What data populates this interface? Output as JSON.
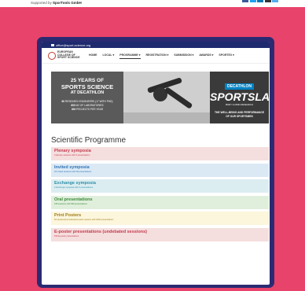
{
  "top": {
    "supported_prefix": "Supported by",
    "supporter": "SporTools GmbH",
    "social_colors": [
      "#3b5998",
      "#1da1f2",
      "#0077b5",
      "#333333",
      "#55acee"
    ]
  },
  "infobar": {
    "email": "office@sport-science.org"
  },
  "nav": {
    "logo_text": "EUROPEAN COLLEGE OF SPORT SCIENCE",
    "items": [
      {
        "label": "HOME",
        "active": false
      },
      {
        "label": "LOCAL ▾",
        "active": false
      },
      {
        "label": "PROGRAMME ▾",
        "active": true
      },
      {
        "label": "REGISTRATION ▾",
        "active": false
      },
      {
        "label": "SUBMISSION ▾",
        "active": false
      },
      {
        "label": "AWARDS ▾",
        "active": false
      },
      {
        "label": "SPORTEX ▾",
        "active": false
      }
    ]
  },
  "hero": {
    "left_title_1": "25 YEARS OF",
    "left_title_2": "SPORTS SCIENCE",
    "left_title_3": "AT DECATHLON",
    "stats": [
      {
        "value": "60",
        "text": " RESEARCH ENGINEERS (17 WITH PHD)"
      },
      {
        "value": "800",
        "text": " M2 OF LABORATORIES"
      },
      {
        "value": "300",
        "text": " PROJECTS PER YEAR"
      }
    ],
    "brand": "DECATHLON",
    "brand_color": "#0082c3",
    "sportslab": "SPORTSLAB",
    "sportslab_sub": "BODY & MIND RESEARCH",
    "tagline_1": "THE WELL-BEING AND PERFORMANCE",
    "tagline_2": "OF OUR SPORTSMEN"
  },
  "heading": "Scientific Programme",
  "sessions": [
    {
      "title": "Plenary symposia",
      "subtitle": "3 plenary sessions with 9 presentations",
      "bg": "#f5dede",
      "color": "#c23b4e"
    },
    {
      "title": "Invited symposia",
      "subtitle": "22 invited sessions with 66 presentations",
      "bg": "#dbe9f5",
      "color": "#2f74b5"
    },
    {
      "title": "Exchange symposia",
      "subtitle": "2 Exchange symposia with 6 presentations",
      "bg": "#dbedf1",
      "color": "#2f8fa8"
    },
    {
      "title": "Oral presentations",
      "subtitle": "165 sessions with 990 presentations",
      "bg": "#e0efdc",
      "color": "#3c8a3a"
    },
    {
      "title": "Print Posters",
      "subtitle": "52 sessions/unmoderated poster session with 1093 presentations",
      "bg": "#fbf6dc",
      "color": "#a07c1c"
    },
    {
      "title": "E-poster presentations (undebated sessions)",
      "subtitle": "530 E-poster presentations",
      "bg": "#f5dede",
      "color": "#c23b4e"
    }
  ]
}
